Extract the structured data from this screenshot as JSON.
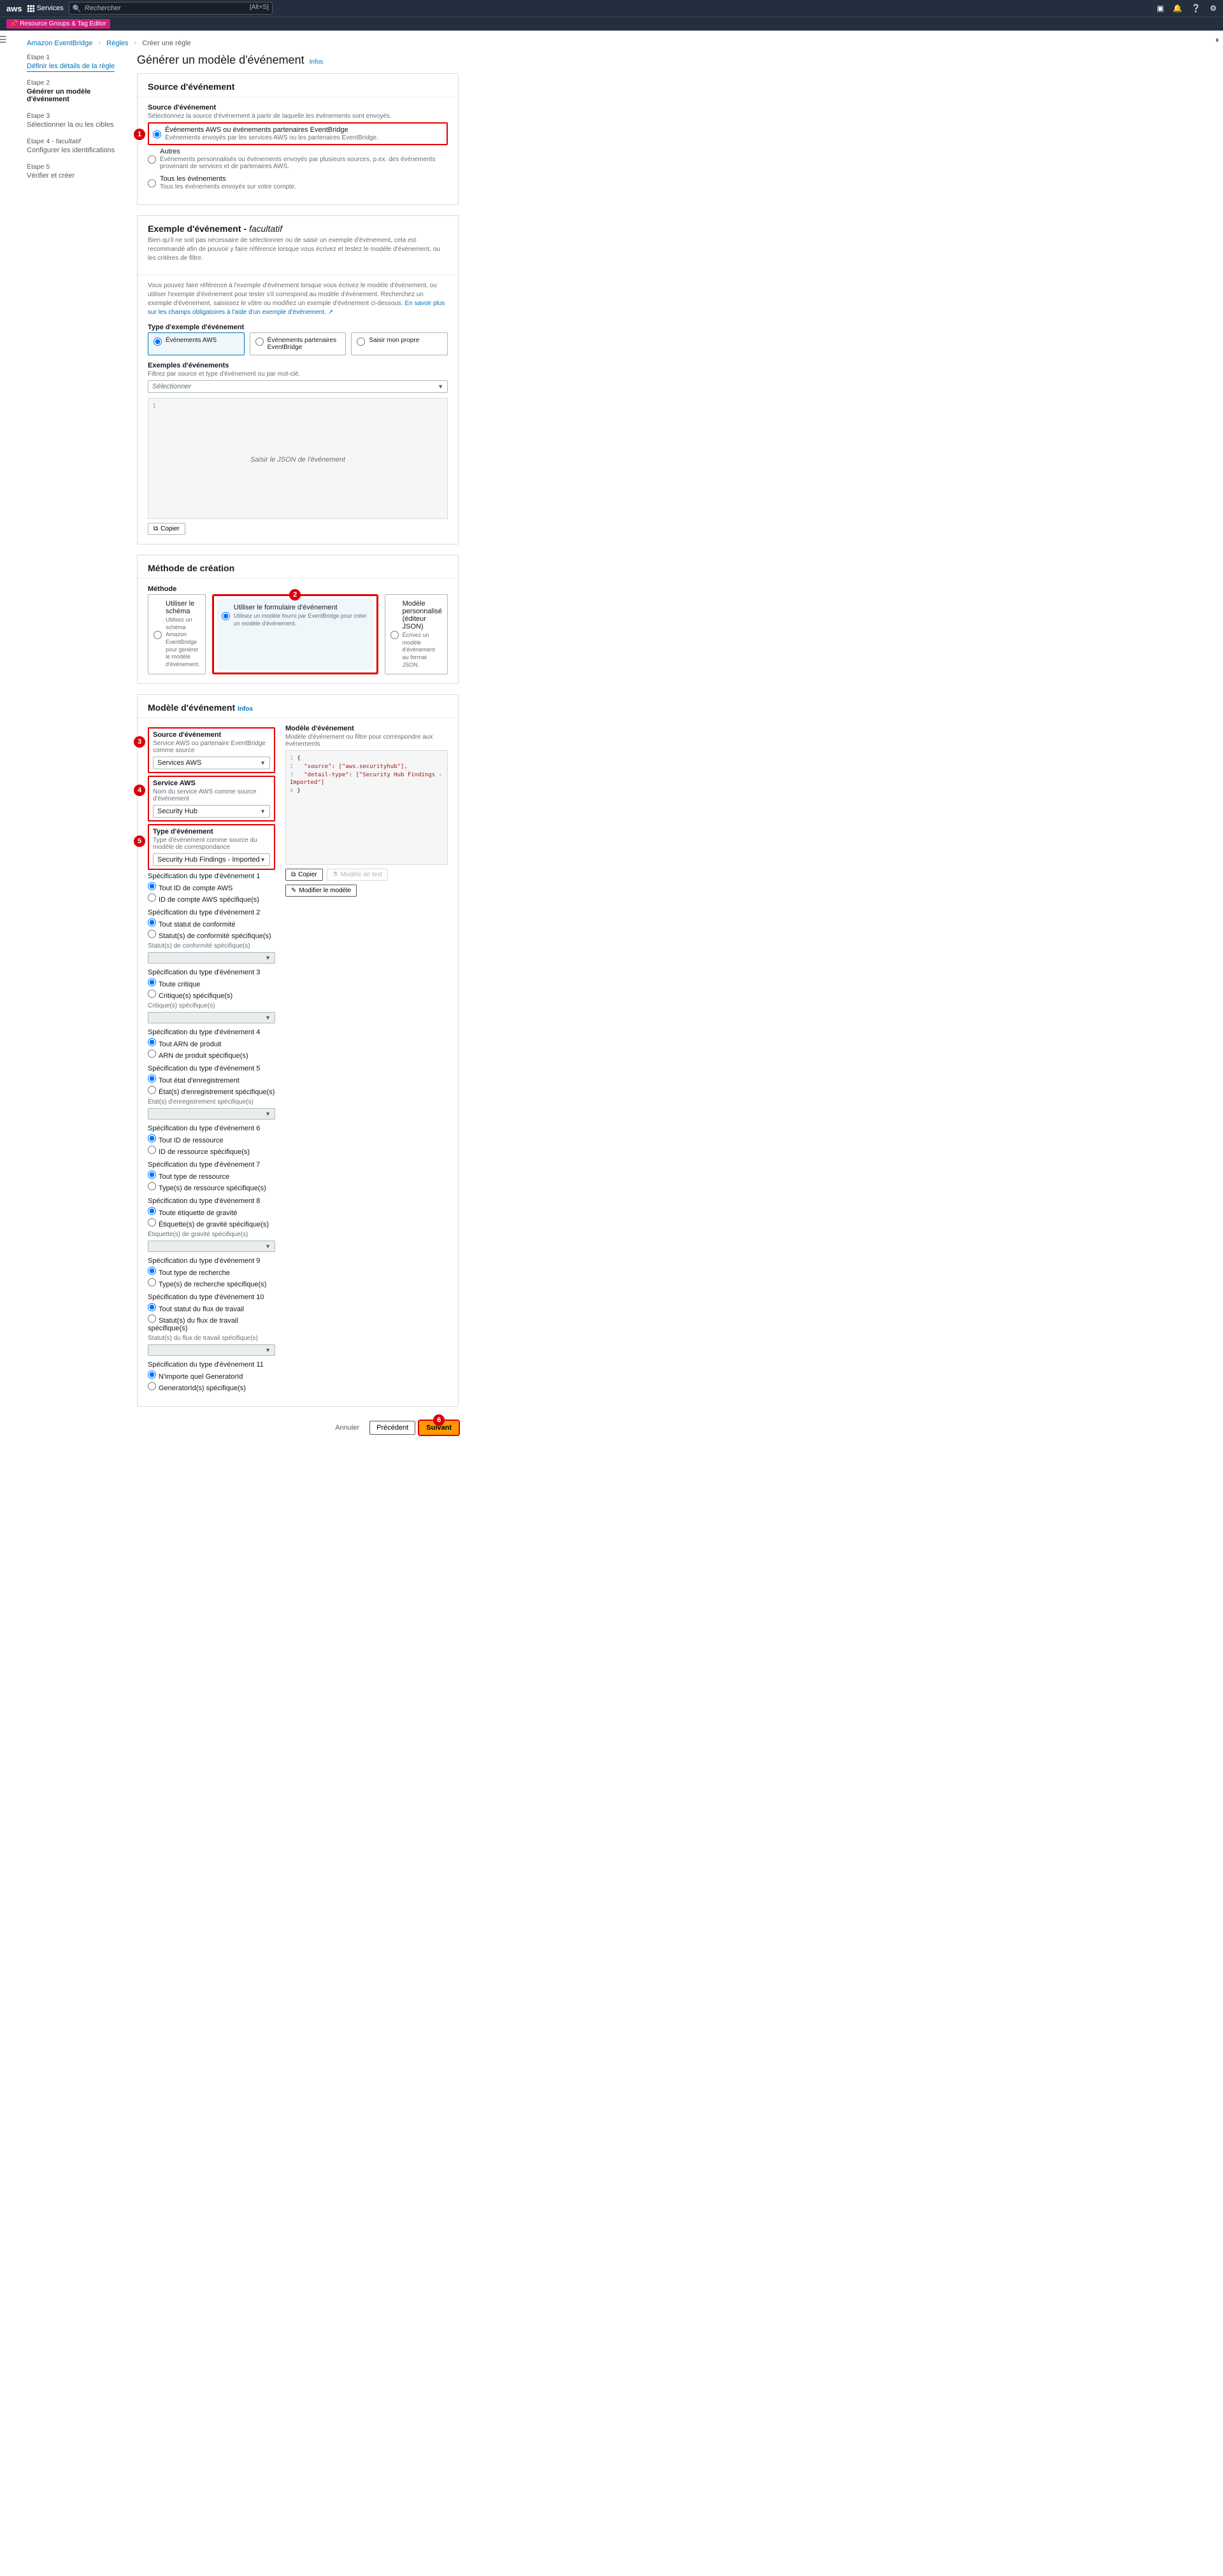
{
  "topbar": {
    "logo": "aws",
    "services": "Services",
    "search_placeholder": "Rechercher",
    "shortcut": "[Alt+S]",
    "resource_groups": "Resource Groups & Tag Editor"
  },
  "breadcrumb": {
    "items": [
      "Amazon EventBridge",
      "Règles",
      "Créer une règle"
    ]
  },
  "steps": {
    "s1_label": "Étape 1",
    "s1_name": "Définir les détails de la règle",
    "s2_label": "Étape 2",
    "s2_name": "Générer un modèle d'événement",
    "s3_label": "Étape 3",
    "s3_name": "Sélectionner la ou les cibles",
    "s4_label": "Étape 4 - ",
    "s4_fac": "facultatif",
    "s4_name": "Configurer les identifications",
    "s5_label": "Étape 5",
    "s5_name": "Vérifier et créer"
  },
  "page": {
    "title": "Générer un modèle d'événement",
    "info": "Infos"
  },
  "source_panel": {
    "header": "Source d'événement",
    "field": "Source d'événement",
    "hint": "Sélectionnez la source d'événement à partir de laquelle les événements sont envoyés.",
    "opt1_title": "Événements AWS ou événements partenaires EventBridge",
    "opt1_desc": "Événements envoyés par les services AWS ou les partenaires EventBridge.",
    "opt2_title": "Autres",
    "opt2_desc": "Événements personnalisés ou événements envoyés par plusieurs sources, p.ex. des événements provenant de services et de partenaires AWS.",
    "opt3_title": "Tous les événements",
    "opt3_desc": "Tous les événements envoyés sur votre compte."
  },
  "sample_panel": {
    "header": "Exemple d'événement - ",
    "header_fac": "facultatif",
    "sub": "Bien qu'il ne soit pas nécessaire de sélectionner ou de saisir un exemple d'événement, cela est recommandé afin de pouvoir y faire référence lorsque vous écrivez et testez le modèle d'événement, ou les critères de filtre.",
    "body": "Vous pouvez faire référence à l'exemple d'événement lorsque vous écrivez le modèle d'événement, ou utiliser l'exemple d'événement pour tester s'il correspond au modèle d'événement. Recherchez un exemple d'événement, saisissez le vôtre ou modifiez un exemple d'événement ci-dessous. ",
    "body_link": "En savoir plus sur les champs obligatoires à l'aide d'un exemple d'événement.",
    "type_label": "Type d'exemple d'événement",
    "tile1": "Événements AWS",
    "tile2": "Événements partenaires EventBridge",
    "tile3": "Saisir mon propre",
    "ex_label": "Exemples d'événements",
    "ex_hint": "Filtrez par source et type d'événement ou par mot-clé.",
    "select_placeholder": "Sélectionner",
    "editor_placeholder": "Saisir le JSON de l'événement",
    "line1": "1",
    "copy": "Copier"
  },
  "method_panel": {
    "header": "Méthode de création",
    "label": "Méthode",
    "m1_title": "Utiliser le schéma",
    "m1_desc": "Utilisez un schéma Amazon EventBridge pour générer le modèle d'événement.",
    "m2_title": "Utiliser le formulaire d'événement",
    "m2_desc": "Utilisez un modèle fourni par EventBridge pour créer un modèle d'événement.",
    "m3_title": "Modèle personnalisé (éditeur JSON)",
    "m3_desc": "Écrivez un modèle d'événement au format JSON."
  },
  "pattern_panel": {
    "header": "Modèle d'événement",
    "info": "Infos",
    "src_label": "Source d'événement",
    "src_hint": "Service AWS ou partenaire EventBridge comme source",
    "src_val": "Services AWS",
    "svc_label": "Service AWS",
    "svc_hint": "Nom du service AWS comme source d'événement",
    "svc_val": "Security Hub",
    "type_label": "Type d'événement",
    "type_hint": "Type d'événement comme source du modèle de correspondance",
    "type_val": "Security Hub Findings - Imported",
    "right_label": "Modèle d'événement",
    "right_hint": "Modèle d'événement ou filtre pour correspondre aux événements",
    "code_l1": "{",
    "code_l2_k": "\"source\"",
    "code_l2_v": ": [\"aws.securityhub\"],",
    "code_l3_k": "\"detail-type\"",
    "code_l3_v": ": [\"Security Hub Findings - Imported\"]",
    "code_l4": "}",
    "copy": "Copier",
    "test": "Modèle de test",
    "edit": "Modifier le modèle",
    "specs": [
      {
        "title": "Spécification du type d'événement 1",
        "r1": "Tout ID de compte AWS",
        "r2": "ID de compte AWS spécifique(s)"
      },
      {
        "title": "Spécification du type d'événement 2",
        "r1": "Tout statut de conformité",
        "r2": "Statut(s) de conformité spécifique(s)",
        "extra_label": "Statut(s) de conformité spécifique(s)"
      },
      {
        "title": "Spécification du type d'événement 3",
        "r1": "Toute critique",
        "r2": "Critique(s) spécifique(s)",
        "extra_label": "Critique(s) spécifique(s)"
      },
      {
        "title": "Spécification du type d'événement 4",
        "r1": "Tout ARN de produit",
        "r2": "ARN de produit spécifique(s)"
      },
      {
        "title": "Spécification du type d'événement 5",
        "r1": "Tout état d'enregistrement",
        "r2": "État(s) d'enregistrement spécifique(s)",
        "extra_label": "État(s) d'enregistrement spécifique(s)"
      },
      {
        "title": "Spécification du type d'événement 6",
        "r1": "Tout ID de ressource",
        "r2": "ID de ressource spécifique(s)"
      },
      {
        "title": "Spécification du type d'événement 7",
        "r1": "Tout type de ressource",
        "r2": "Type(s) de ressource spécifique(s)"
      },
      {
        "title": "Spécification du type d'événement 8",
        "r1": "Toute étiquette de gravité",
        "r2": "Étiquette(s) de gravité spécifique(s)",
        "extra_label": "Étiquette(s) de gravité spécifique(s)"
      },
      {
        "title": "Spécification du type d'événement 9",
        "r1": "Tout type de recherche",
        "r2": "Type(s) de recherche spécifique(s)"
      },
      {
        "title": "Spécification du type d'événement 10",
        "r1": "Tout statut du flux de travail",
        "r2": "Statut(s) du flux de travail spécifique(s)",
        "extra_label": "Statut(s) du flux de travail spécifique(s)"
      },
      {
        "title": "Spécification du type d'événement 11",
        "r1": "N'importe quel GeneratorId",
        "r2": "GeneratorId(s) spécifique(s)"
      }
    ]
  },
  "footer": {
    "cancel": "Annuler",
    "prev": "Précédent",
    "next": "Suivant"
  }
}
